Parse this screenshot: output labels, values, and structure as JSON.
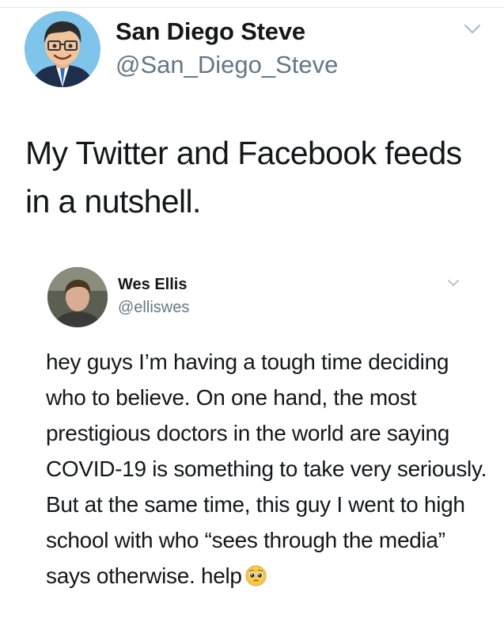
{
  "tweet": {
    "author": {
      "display_name": "San Diego Steve",
      "handle": "@San_Diego_Steve",
      "avatar_icon": "cartoon-avatar-icon"
    },
    "text": "My Twitter and Facebook feeds in a nutshell.",
    "menu_icon": "chevron-down-icon"
  },
  "quoted_tweet": {
    "author": {
      "display_name": "Wes Ellis",
      "handle": "@elliswes",
      "avatar_icon": "profile-photo-icon"
    },
    "text": "hey guys I’m having a tough time deciding who to believe. On one hand, the most prestigious doctors in the world are saying COVID-19 is something to take very seriously. But at the same time, this guy I went to high school with who “sees through the media” says otherwise. help",
    "trailing_emoji": "pleading-face-emoji",
    "menu_icon": "chevron-down-icon"
  },
  "colors": {
    "text_primary": "#14171a",
    "text_secondary": "#657786",
    "divider": "#e1e8ed",
    "chevron": "#aab8c2"
  }
}
